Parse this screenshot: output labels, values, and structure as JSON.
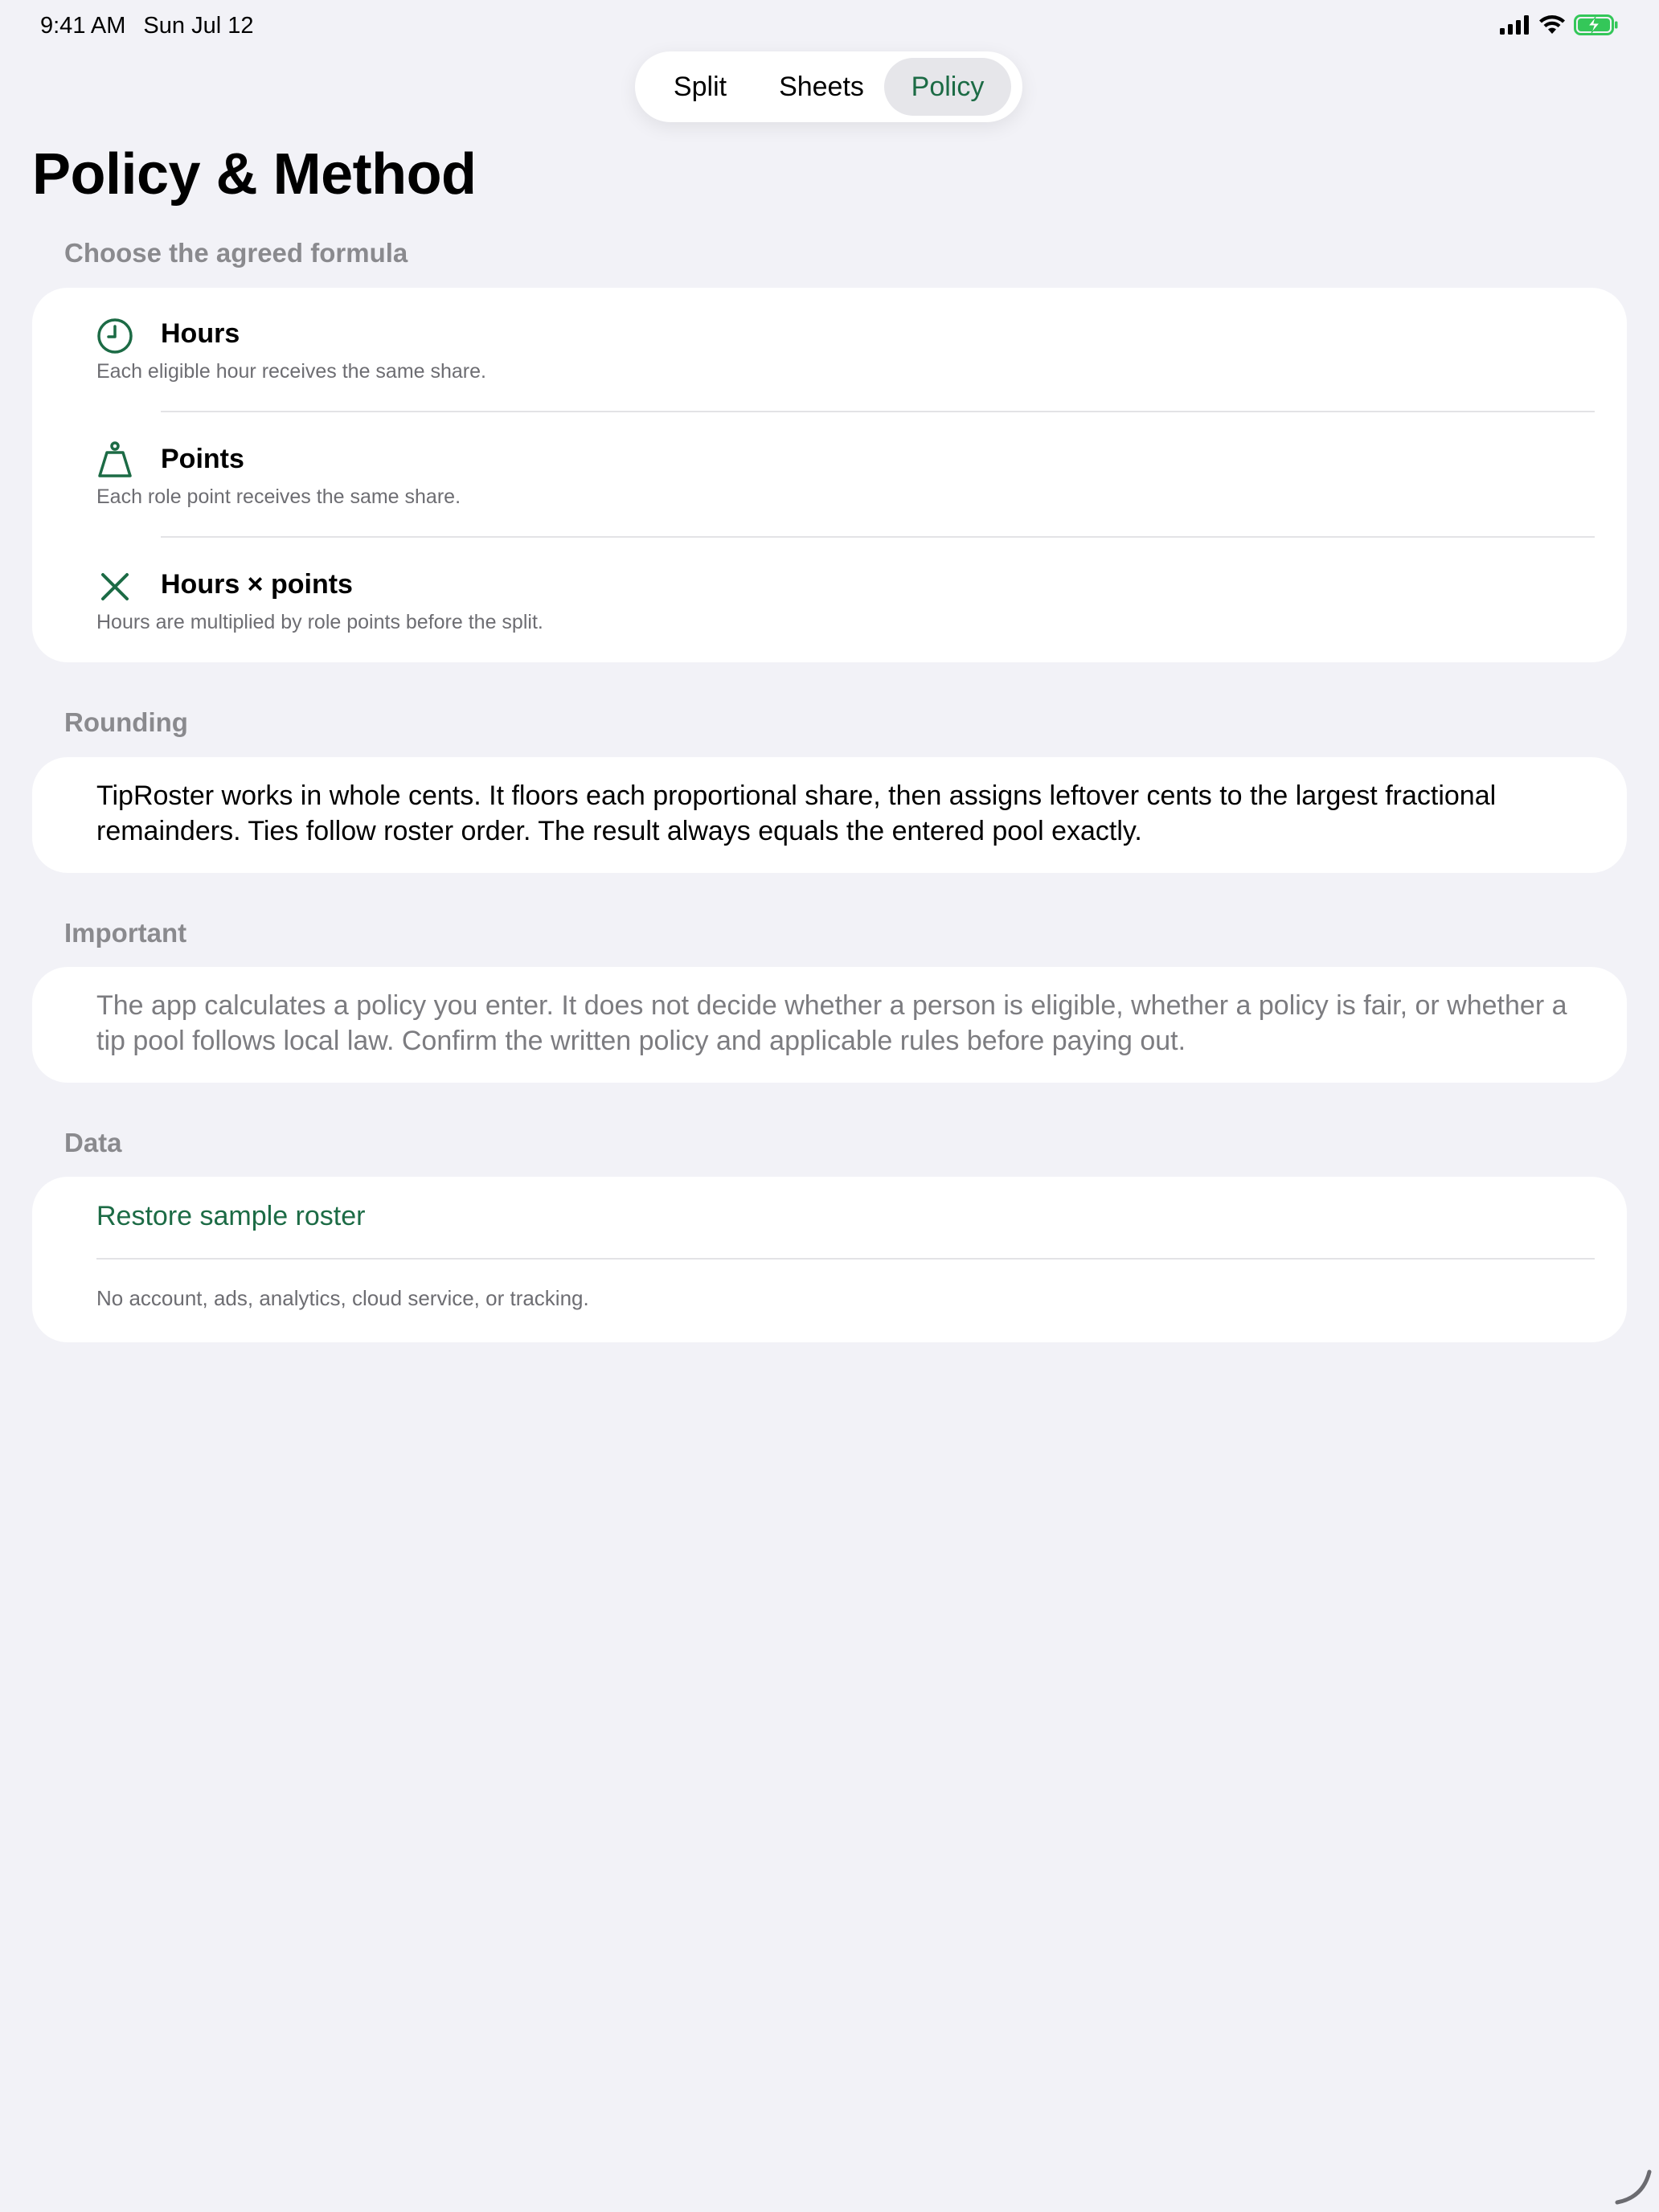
{
  "status_bar": {
    "time": "9:41 AM",
    "date": "Sun Jul 12",
    "icons": [
      "cellular-signal-icon",
      "wifi-icon",
      "battery-charging-icon"
    ]
  },
  "tabs": [
    {
      "label": "Split"
    },
    {
      "label": "Sheets"
    },
    {
      "label": "Policy",
      "selected": true
    }
  ],
  "page": {
    "title": "Policy & Method"
  },
  "formula": {
    "header": "Choose the agreed formula",
    "options": [
      {
        "icon": "clock-icon",
        "title": "Hours",
        "description": "Each eligible hour receives the same share."
      },
      {
        "icon": "weight-icon",
        "title": "Points",
        "description": "Each role point receives the same share."
      },
      {
        "icon": "multiply-icon",
        "title": "Hours × points",
        "description": "Hours are multiplied by role points before the split."
      }
    ]
  },
  "rounding": {
    "header": "Rounding",
    "text": "TipRoster works in whole cents. It floors each proportional share, then assigns leftover cents to the largest fractional remainders. Ties follow roster order. The result always equals the entered pool exactly."
  },
  "important": {
    "header": "Important",
    "text": "The app calculates a policy you enter. It does not decide whether a person is eligible, whether a policy is fair, or whether a tip pool follows local law. Confirm the written policy and applicable rules before paying out."
  },
  "data_section": {
    "header": "Data",
    "restore_label": "Restore sample roster",
    "note": "No account, ads, analytics, cloud service, or tracking."
  },
  "colors": {
    "accent": "#1c6b45",
    "background": "#f2f2f7",
    "card": "#ffffff",
    "secondary_text": "#8a8a8e"
  }
}
